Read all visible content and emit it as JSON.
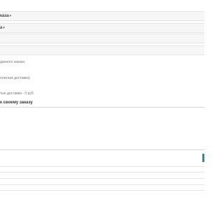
{
  "page": {
    "title": "каза"
  },
  "form": {
    "select_1_label": "каза",
    "select_2_label": "а",
    "caret": "▾",
    "note_1": "данного заказа",
    "note_2": "платная доставка)",
    "note_3": "тью доставки - 0 руб.",
    "comment_title": "к своему заказу"
  }
}
